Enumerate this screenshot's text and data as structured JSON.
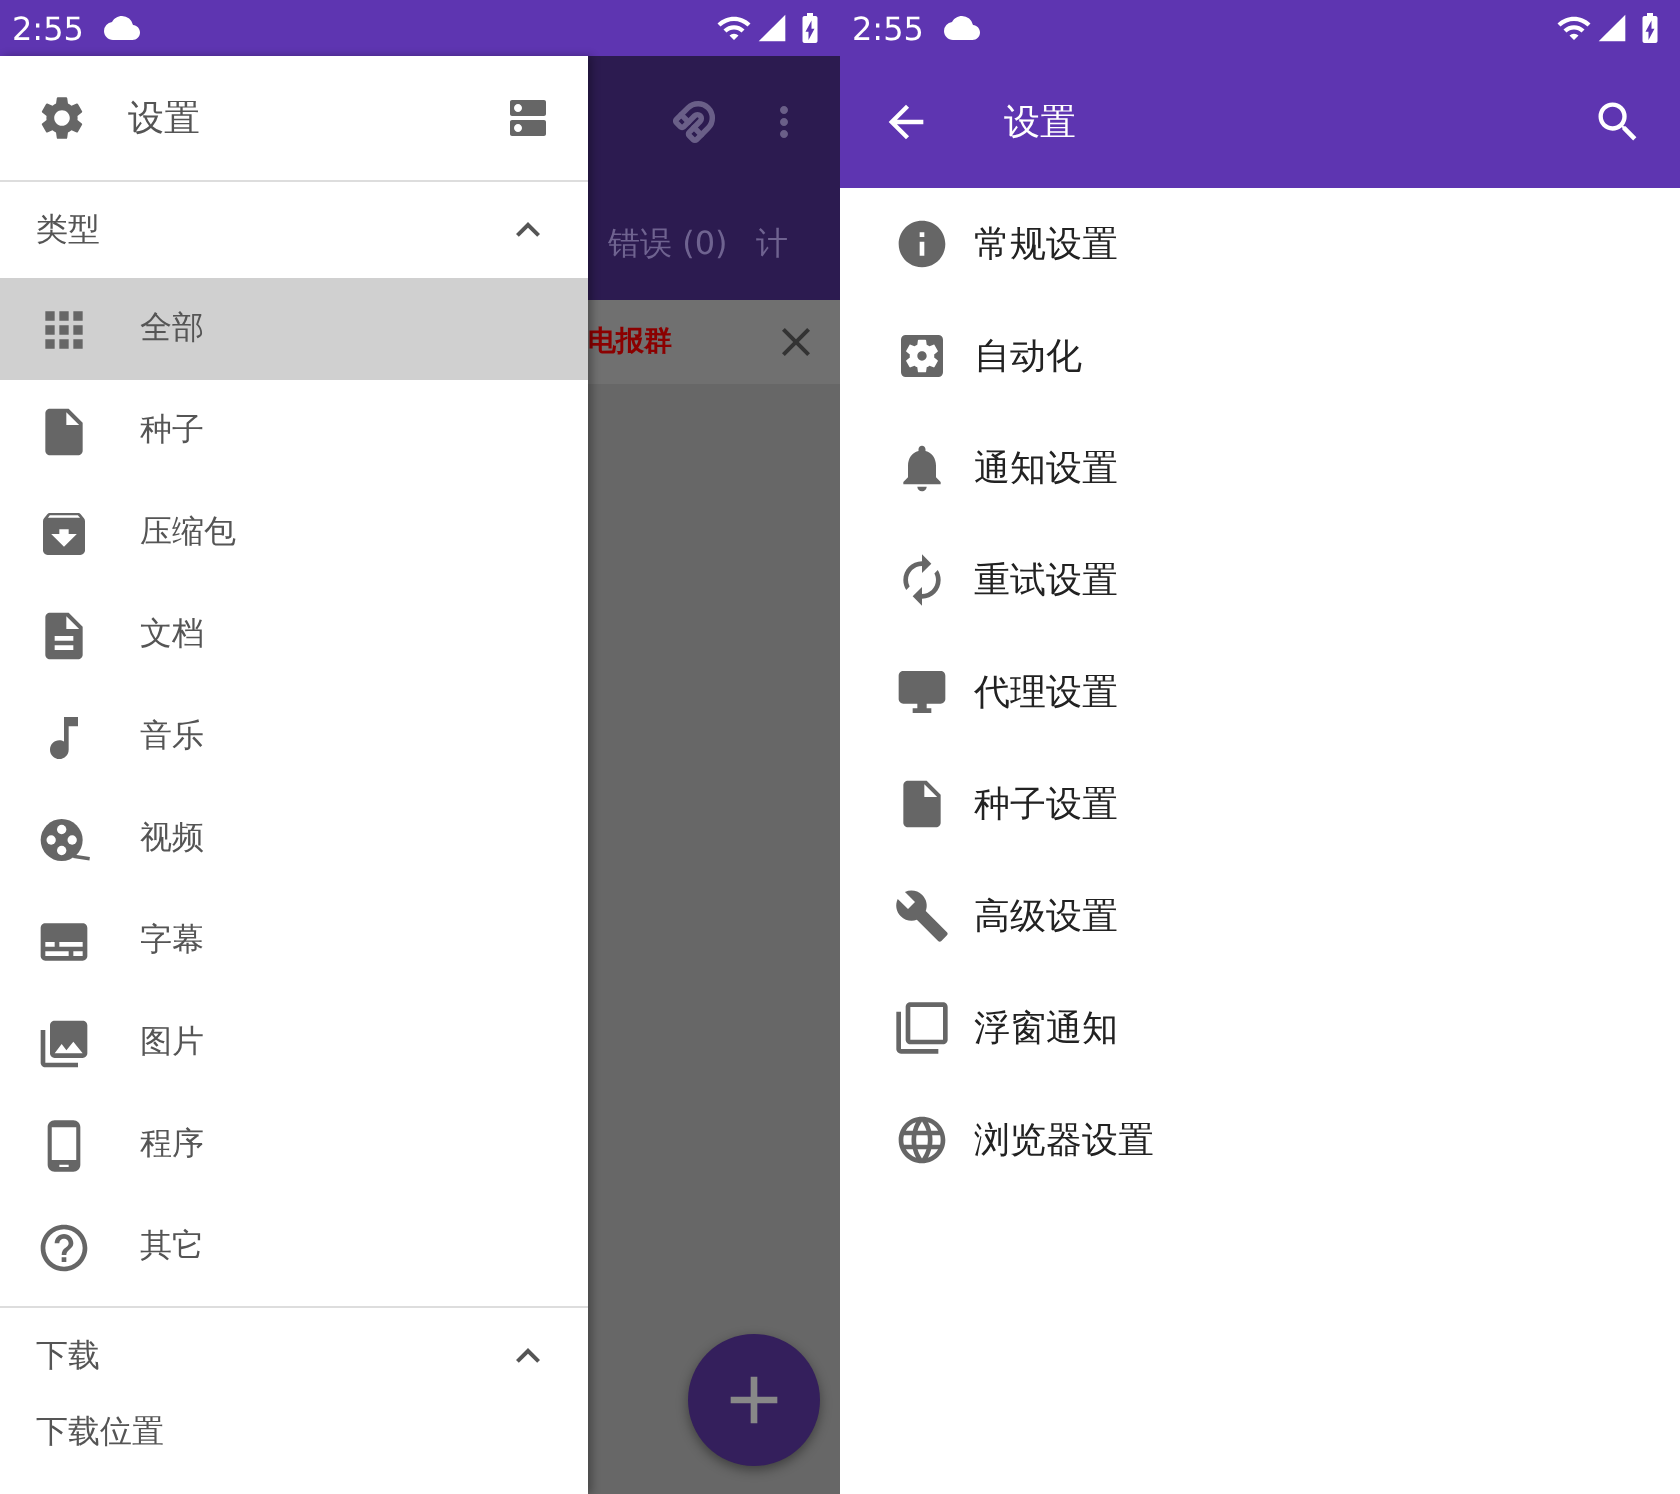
{
  "left_screen": {
    "status_bar": {
      "time": "2:55"
    },
    "drawer": {
      "header": {
        "title": "设置"
      },
      "sections": [
        {
          "title": "类型",
          "expanded": true,
          "items": [
            {
              "label": "全部",
              "kind": "grid",
              "selected": true
            },
            {
              "label": "种子",
              "kind": "torrent",
              "selected": false
            },
            {
              "label": "压缩包",
              "kind": "zip",
              "selected": false
            },
            {
              "label": "文档",
              "kind": "doc",
              "selected": false
            },
            {
              "label": "音乐",
              "kind": "music",
              "selected": false
            },
            {
              "label": "视频",
              "kind": "video",
              "selected": false
            },
            {
              "label": "字幕",
              "kind": "subtitle",
              "selected": false
            },
            {
              "label": "图片",
              "kind": "picture",
              "selected": false
            },
            {
              "label": "程序",
              "kind": "app",
              "selected": false
            },
            {
              "label": "其它",
              "kind": "other",
              "selected": false
            }
          ]
        },
        {
          "title": "下载",
          "expanded": true,
          "items": [
            {
              "label": "下载位置",
              "selected": false
            }
          ]
        }
      ]
    },
    "background_app": {
      "tabs": [
        {
          "label": "错误 (0)"
        },
        {
          "label": "计"
        }
      ],
      "banner": {
        "text": "电报群"
      }
    }
  },
  "right_screen": {
    "status_bar": {
      "time": "2:55"
    },
    "app_bar": {
      "title": "设置"
    },
    "items": [
      {
        "label": "常规设置",
        "kind": "info"
      },
      {
        "label": "自动化",
        "kind": "automation"
      },
      {
        "label": "通知设置",
        "kind": "bell"
      },
      {
        "label": "重试设置",
        "kind": "retry"
      },
      {
        "label": "代理设置",
        "kind": "proxy"
      },
      {
        "label": "种子设置",
        "kind": "torrent"
      },
      {
        "label": "高级设置",
        "kind": "wrench"
      },
      {
        "label": "浮窗通知",
        "kind": "windows"
      },
      {
        "label": "浏览器设置",
        "kind": "globe"
      }
    ]
  }
}
